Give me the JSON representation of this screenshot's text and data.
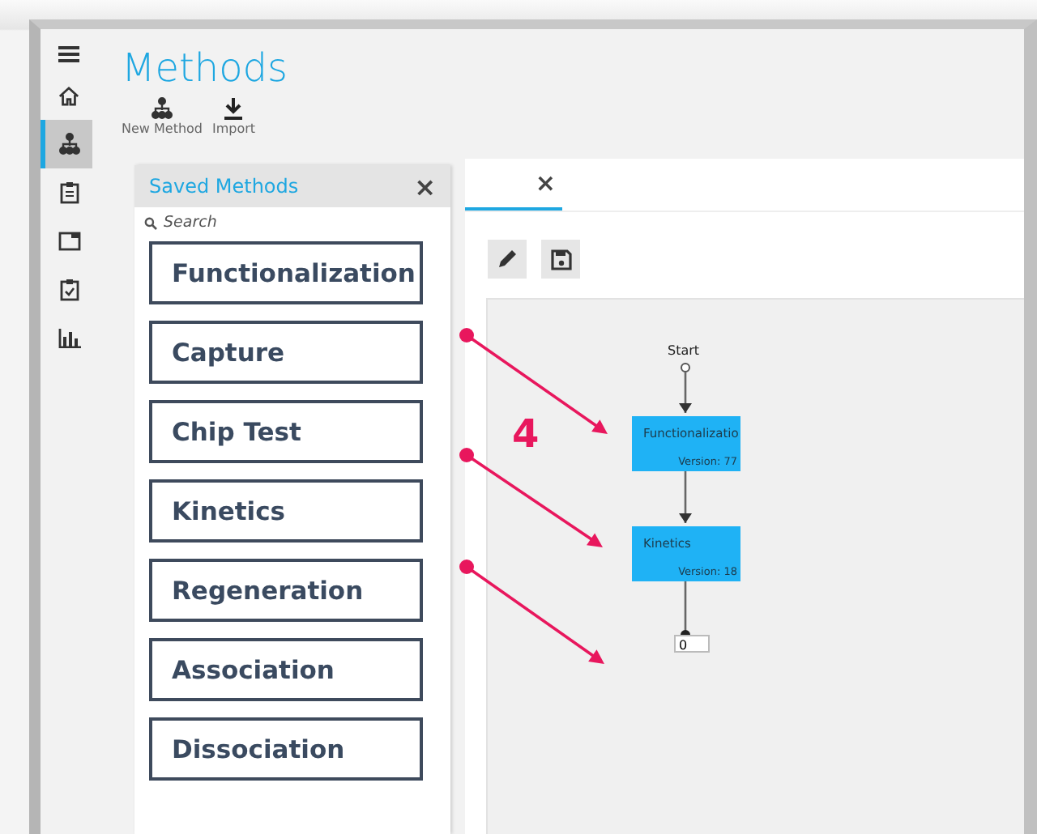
{
  "sidebar": {
    "items": [
      {
        "kind": "home",
        "selected": false
      },
      {
        "kind": "hierarchy",
        "selected": true
      },
      {
        "kind": "clipboard",
        "selected": false
      },
      {
        "kind": "window",
        "selected": false
      },
      {
        "kind": "clipboard-check",
        "selected": false
      },
      {
        "kind": "chart",
        "selected": false
      }
    ]
  },
  "page": {
    "title": "Methods"
  },
  "toolbar": [
    {
      "kind": "hierarchy",
      "label": "New Method"
    },
    {
      "kind": "import",
      "label": "Import"
    }
  ],
  "saved_methods": {
    "title": "Saved Methods",
    "close": "×",
    "search": {
      "placeholder": "Search"
    },
    "items": [
      "Functionalization",
      "Capture",
      "Chip Test",
      "Kinetics",
      "Regeneration",
      "Association",
      "Dissociation"
    ]
  },
  "editor": {
    "tab": {
      "close": "×",
      "selected": true
    },
    "buttons": [
      {
        "kind": "pencil"
      },
      {
        "kind": "save"
      }
    ],
    "flow": {
      "start": "Start",
      "nodes": [
        {
          "name": "Functionalizatio",
          "version": "Version: 77"
        },
        {
          "name": "Kinetics",
          "version": "Version: 18"
        }
      ],
      "end_value": "0"
    }
  },
  "annotation": {
    "number": "4"
  }
}
